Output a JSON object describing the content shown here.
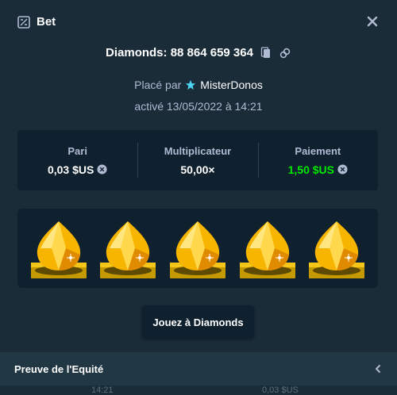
{
  "header": {
    "title": "Bet",
    "bet_icon": "bet-slip-icon",
    "close_icon": "close-icon"
  },
  "game": {
    "title": "Diamonds: 88 864 659 364",
    "copy_icon": "copy-icon",
    "link_icon": "link-icon"
  },
  "placed": {
    "prefix": "Placé par",
    "user": "MisterDonos",
    "user_icon": "star-icon"
  },
  "date": "activé 13/05/2022 à 14:21",
  "stats": {
    "bet": {
      "label": "Pari",
      "value": "0,03 $US",
      "icon": "currency-icon"
    },
    "multiplier": {
      "label": "Multiplicateur",
      "value": "50,00×"
    },
    "payout": {
      "label": "Paiement",
      "value": "1,50 $US",
      "icon": "currency-icon",
      "color": "#00e701"
    }
  },
  "gems": [
    "yellow-diamond",
    "yellow-diamond",
    "yellow-diamond",
    "yellow-diamond",
    "yellow-diamond"
  ],
  "play_button": "Jouez à Diamonds",
  "fairness": {
    "label": "Preuve de l'Equité",
    "icon": "chevron-left-icon"
  },
  "behind": {
    "left": "14:21",
    "right": "0,03 $US"
  },
  "colors": {
    "background": "#1a2c38",
    "panel": "#0f212e",
    "green": "#00e701",
    "muted": "#b1bad3"
  }
}
